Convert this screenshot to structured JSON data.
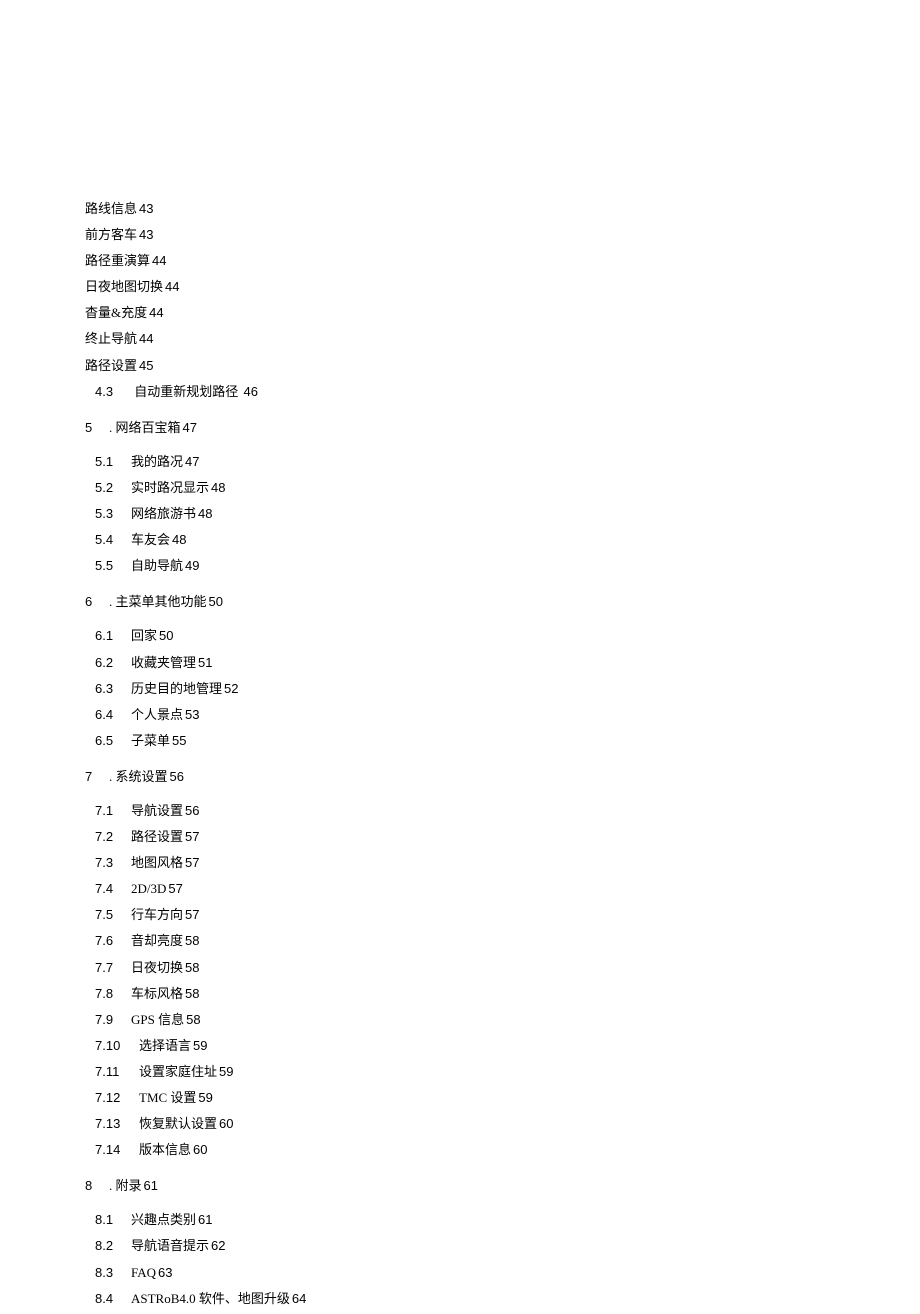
{
  "plain": [
    {
      "title": "路线信息",
      "page": "43"
    },
    {
      "title": "前方客车",
      "page": "43"
    },
    {
      "title": "路径重演算",
      "page": "44"
    },
    {
      "title": " 日夜地图切换",
      "page": "44"
    },
    {
      "title": "杳量&充度",
      "page": "44"
    },
    {
      "title": "终止导航",
      "page": "44"
    },
    {
      "title": "路径设置",
      "page": "45"
    }
  ],
  "sub43": {
    "num": "4.3",
    "title": "自动重新规划路径",
    "page": "46"
  },
  "sec5": {
    "num": "5",
    "title": ". 网络百宝箱",
    "page": "47",
    "items": [
      {
        "num": "5.1",
        "title": "我的路况",
        "page": "47"
      },
      {
        "num": "5.2",
        "title": "实时路况显示",
        "page": "48"
      },
      {
        "num": "5.3",
        "title": "网络旅游书",
        "page": "48"
      },
      {
        "num": "5.4",
        "title": "车友会",
        "page": "48"
      },
      {
        "num": "5.5",
        "title": "自助导航",
        "page": "49"
      }
    ]
  },
  "sec6": {
    "num": "6",
    "title": ". 主菜单其他功能",
    "page": "50",
    "items": [
      {
        "num": "6.1",
        "title": "回家",
        "page": "50"
      },
      {
        "num": "6.2",
        "title": "收藏夹管理",
        "page": "51"
      },
      {
        "num": "6.3",
        "title": "历史目的地管理",
        "page": "52"
      },
      {
        "num": "6.4",
        "title": "个人景点",
        "page": "53"
      },
      {
        "num": "6.5",
        "title": "子菜单",
        "page": "55"
      }
    ]
  },
  "sec7": {
    "num": "7",
    "title": ". 系统设置",
    "page": "56",
    "items": [
      {
        "num": "7.1",
        "title": "导航设置",
        "page": "56"
      },
      {
        "num": "7.2",
        "title": "路径设置",
        "page": "57"
      },
      {
        "num": "7.3",
        "title": "地图风格",
        "page": "57"
      },
      {
        "num": "7.4",
        "title": "2D/3D",
        "page": "57"
      },
      {
        "num": "7.5",
        "title": "行车方向",
        "page": "57"
      },
      {
        "num": "7.6",
        "title": "音却亮度",
        "page": "58"
      },
      {
        "num": "7.7",
        "title": "日夜切换",
        "page": "58"
      },
      {
        "num": "7.8",
        "title": "车标风格",
        "page": "58"
      },
      {
        "num": "7.9",
        "title": "GPS 信息",
        "page": "58"
      },
      {
        "num": "7.10",
        "title": "选择语言",
        "page": "59"
      },
      {
        "num": "7.11",
        "title": "设置家庭住址",
        "page": "59"
      },
      {
        "num": "7.12",
        "title": "TMC 设置",
        "page": "59"
      },
      {
        "num": "7.13",
        "title": "恢复默认设置",
        "page": "60"
      },
      {
        "num": "7.14",
        "title": "版本信息",
        "page": "60"
      }
    ]
  },
  "sec8": {
    "num": "8",
    "title": ". 附录",
    "page": "61",
    "items": [
      {
        "num": "8.1",
        "title": "兴趣点类别",
        "page": "61"
      },
      {
        "num": "8.2",
        "title": "导航语音提示",
        "page": "62"
      },
      {
        "num": "8.3",
        "title": "FAQ",
        "page": "63"
      },
      {
        "num": "8.4",
        "title": "ASTRoB4.0 软件、地图升级",
        "page": "64"
      }
    ]
  }
}
